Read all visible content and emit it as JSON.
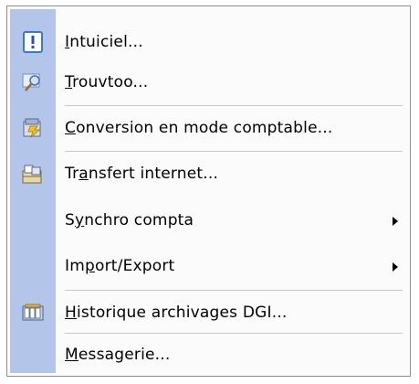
{
  "menu": {
    "items": [
      {
        "pre": "",
        "ul": "I",
        "post": "ntuiciel...",
        "icon": "info-icon",
        "submenu": false
      },
      {
        "pre": "",
        "ul": "T",
        "post": "rouvtoo...",
        "icon": "search-icon",
        "submenu": false
      },
      {
        "pre": "",
        "ul": "C",
        "post": "onversion en mode comptable...",
        "icon": "conversion-icon",
        "submenu": false
      },
      {
        "pre": "Tr",
        "ul": "a",
        "post": "nsfert internet...",
        "icon": "transfer-icon",
        "submenu": false
      },
      {
        "pre": "S",
        "ul": "y",
        "post": "nchro compta",
        "icon": "",
        "submenu": true
      },
      {
        "pre": "Im",
        "ul": "p",
        "post": "ort/Export",
        "icon": "",
        "submenu": true
      },
      {
        "pre": "",
        "ul": "H",
        "post": "istorique archivages DGI...",
        "icon": "archive-icon",
        "submenu": false
      },
      {
        "pre": "",
        "ul": "M",
        "post": "essagerie...",
        "icon": "",
        "submenu": false
      }
    ]
  },
  "colors": {
    "gutter": "#b3c6ea",
    "menu_background": "#fbfbfb",
    "border": "#8f8f8f",
    "separator": "#c9c9c9"
  }
}
